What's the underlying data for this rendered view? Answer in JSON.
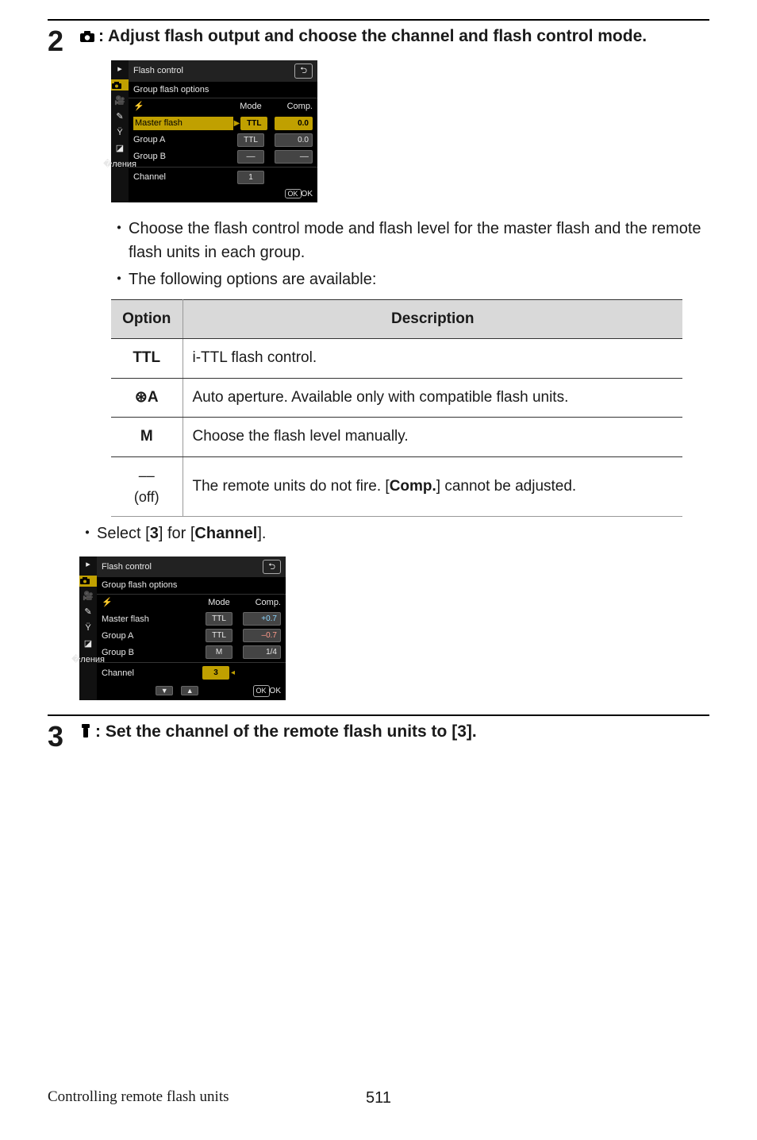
{
  "step2": {
    "num": "2",
    "icon": "camera-icon",
    "heading": ": Adjust flash output and choose the channel and flash control mode."
  },
  "screen1": {
    "title": "Flash control",
    "back": "⮌",
    "subhead": "Group flash options",
    "head_mode": "Mode",
    "head_comp": "Comp.",
    "flash_icon": "⚡",
    "rows": [
      {
        "name": "Master flash",
        "mode": "TTL",
        "comp": "0.0",
        "hl": true,
        "cursor": true
      },
      {
        "name": "Group A",
        "mode": "TTL",
        "comp": "0.0"
      },
      {
        "name": "Group B",
        "mode": "––",
        "comp": "––"
      }
    ],
    "channel_label": "Channel",
    "channel_value": "1",
    "ok_btn": "OK",
    "ok_label": "OK"
  },
  "bullets1": [
    "Choose the flash control mode and flash level for the master flash and the remote flash units in each group.",
    "The following options are available:"
  ],
  "table": {
    "head_option": "Option",
    "head_desc": "Description",
    "rows": [
      {
        "opt": "TTL",
        "desc": "i-TTL flash control."
      },
      {
        "opt": "⊛A",
        "desc": "Auto aperture. Available only with compatible flash units."
      },
      {
        "opt": "M",
        "desc": "Choose the flash level manually."
      },
      {
        "opt_glyph": "––",
        "opt_sub": "(off)",
        "desc_pre": "The remote units do not fire. [",
        "desc_bold": "Comp.",
        "desc_post": "] cannot be adjusted."
      }
    ]
  },
  "bullet2_pre": "Select [",
  "bullet2_b1": "3",
  "bullet2_mid": "] for [",
  "bullet2_b2": "Channel",
  "bullet2_post": "].",
  "screen2": {
    "title": "Flash control",
    "back": "⮌",
    "subhead": "Group flash options",
    "head_mode": "Mode",
    "head_comp": "Comp.",
    "flash_icon": "⚡",
    "rows": [
      {
        "name": "Master flash",
        "mode": "TTL",
        "comp": "+0.7",
        "compcls": "plus"
      },
      {
        "name": "Group A",
        "mode": "TTL",
        "comp": "–0.7",
        "compcls": "minus"
      },
      {
        "name": "Group B",
        "mode": "M",
        "comp": "1/4"
      }
    ],
    "channel_label": "Channel",
    "channel_value": "3",
    "chan_hl": true,
    "down_arrow": "▼",
    "up_arrow": "▲",
    "ok_btn": "OK",
    "ok_label": "OK"
  },
  "step3": {
    "num": "3",
    "icon": "flash-unit-icon",
    "heading": ": Set the channel of the remote flash units to [3]."
  },
  "footer": {
    "section": "Controlling remote flash units",
    "page": "511"
  }
}
